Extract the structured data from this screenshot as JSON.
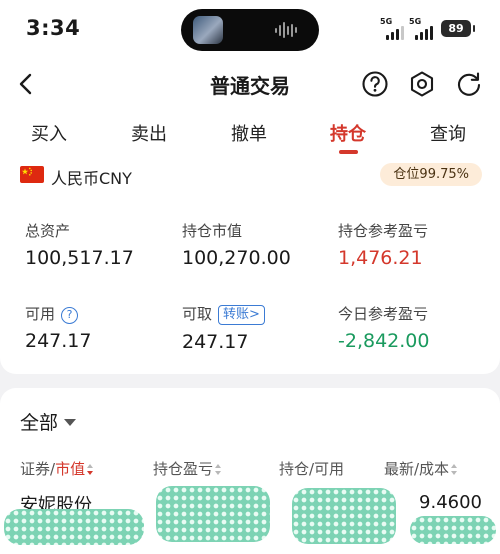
{
  "status_bar": {
    "time": "3:34",
    "network": [
      "5G",
      "5G"
    ],
    "battery": "89",
    "icons": [
      "dynamic-island",
      "music-waveform-icon",
      "signal-icon",
      "battery-icon"
    ]
  },
  "nav": {
    "title": "普通交易",
    "icons": [
      "back-arrow-icon",
      "question-circle-icon",
      "settings-gear-icon",
      "refresh-icon"
    ]
  },
  "tabs": [
    {
      "label": "买入",
      "active": false
    },
    {
      "label": "卖出",
      "active": false
    },
    {
      "label": "撤单",
      "active": false
    },
    {
      "label": "持仓",
      "active": true
    },
    {
      "label": "查询",
      "active": false
    }
  ],
  "account": {
    "flag_icon": "china-flag-icon",
    "currency": "人民币CNY",
    "position_ratio": "仓位99.75%"
  },
  "summary": {
    "total_assets_label": "总资产",
    "total_assets": "100,517.17",
    "market_value_label": "持仓市值",
    "market_value": "100,270.00",
    "position_pnl_label": "持仓参考盈亏",
    "position_pnl": "1,476.21",
    "available_label": "可用",
    "available": "247.17",
    "withdrawable_label": "可取",
    "withdrawable": "247.17",
    "transfer_label": "转账>",
    "today_pnl_label": "今日参考盈亏",
    "today_pnl": "-2,842.00"
  },
  "holdings": {
    "filter_label": "全部",
    "columns": {
      "security_label": "证券/",
      "security_sort_label": "市值",
      "pnl_label": "持仓盈亏",
      "qty_label": "持仓/可用",
      "price_label": "最新/成本"
    },
    "rows": [
      {
        "name": "安妮股份",
        "price": "9.4600"
      }
    ]
  },
  "colors": {
    "accent_red": "#d4382c",
    "gain_red": "#d4382c",
    "loss_green": "#1a9a5e",
    "link_blue": "#3b7bd4",
    "badge_bg": "#fdecd9",
    "redaction_teal": "#7dd3b4"
  }
}
